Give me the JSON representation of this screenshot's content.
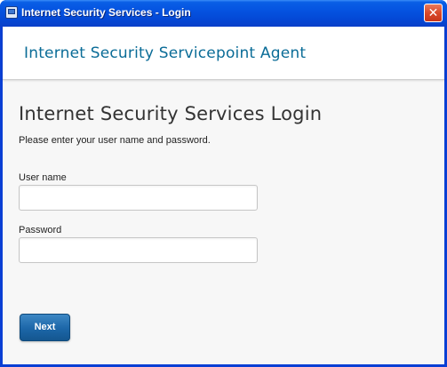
{
  "window": {
    "title": "Internet Security Services - Login",
    "close_glyph": "✕"
  },
  "brand": {
    "name": "Internet Security Servicepoint Agent"
  },
  "login": {
    "heading": "Internet Security Services Login",
    "instructions": "Please enter your user name and password.",
    "username_label": "User name",
    "username_value": "",
    "password_label": "Password",
    "password_value": "",
    "next_label": "Next"
  },
  "colors": {
    "brand_text": "#0a6c97",
    "button": "#1c66a8",
    "titlebar": "#0553e0",
    "close": "#d9492a"
  },
  "icons": {
    "window_icon": "app-window-icon",
    "close": "close-icon"
  }
}
